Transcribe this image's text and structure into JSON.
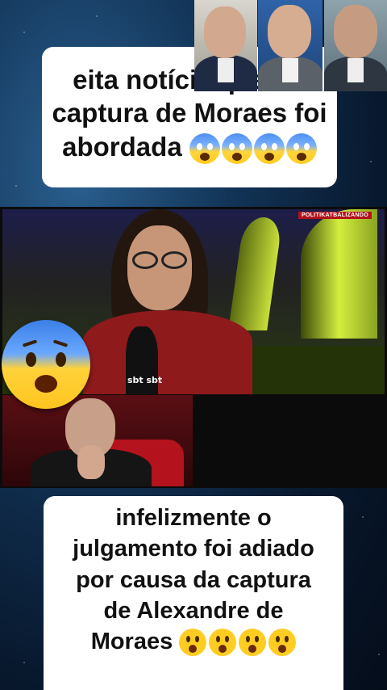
{
  "top_caption": {
    "line1": "eita notícia quente",
    "line2": "captura de Moraes foi",
    "line3": "abordada",
    "emoji_icon": "face-screaming-in-fear-icon",
    "emoji_count": 4
  },
  "news_frame": {
    "watermark": "POLITIKATBALIZANDO",
    "mic_label": "sbt sbt"
  },
  "bottom_caption": {
    "line1": "infelizmente o",
    "line2": "julgamento foi adiado",
    "line3": "por causa da captura",
    "line4": "de Alexandre de",
    "line5": "Moraes",
    "emoji_icon": "astonished-face-icon",
    "emoji_count": 4
  },
  "colors": {
    "caption_bg": "#ffffff",
    "caption_text": "#111111",
    "watermark_bg": "#b3121a"
  }
}
